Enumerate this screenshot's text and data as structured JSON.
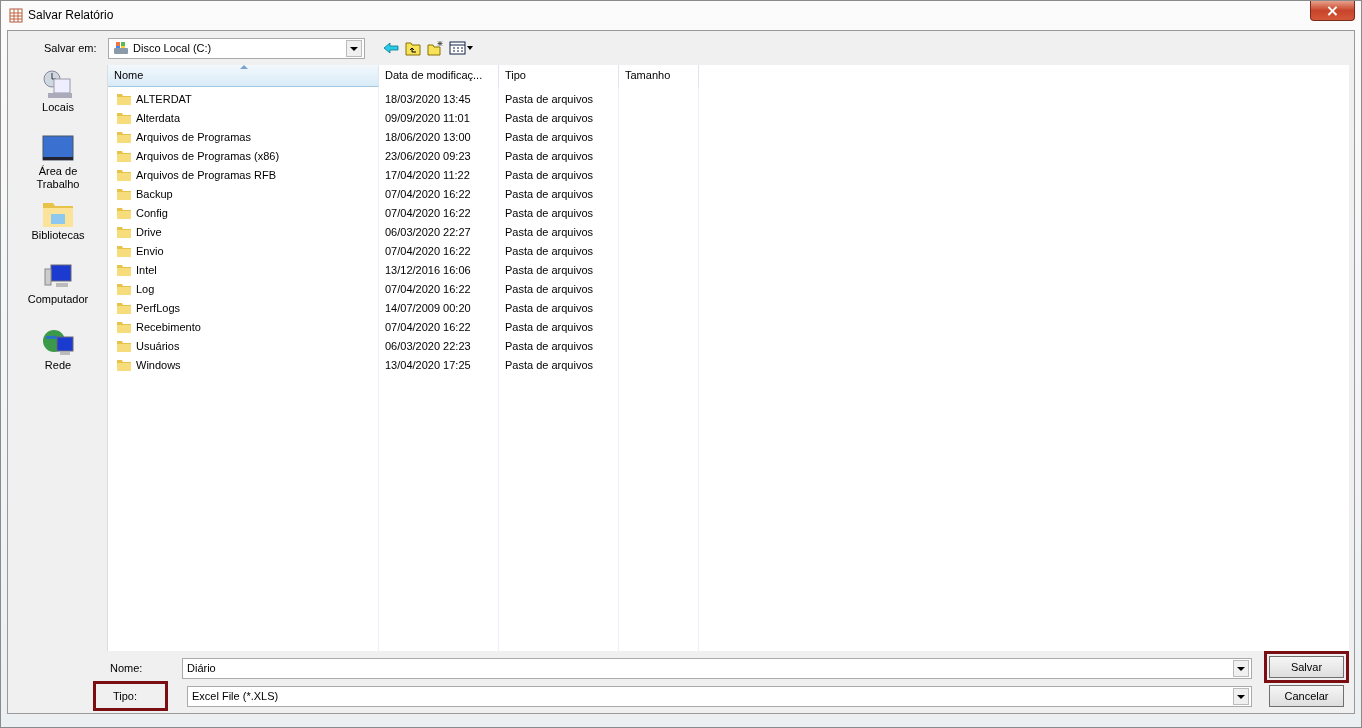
{
  "window": {
    "title": "Salvar Relatório",
    "close": "×"
  },
  "location": {
    "label": "Salvar em:",
    "value": "Disco Local (C:)"
  },
  "toolbar": [
    {
      "kind": "back"
    },
    {
      "kind": "up"
    },
    {
      "kind": "new-folder"
    },
    {
      "kind": "view"
    }
  ],
  "sidebar": {
    "items": [
      {
        "label": "Locais",
        "kind": "recent"
      },
      {
        "label": "Área de Trabalho",
        "kind": "desktop"
      },
      {
        "label": "Bibliotecas",
        "kind": "libraries"
      },
      {
        "label": "Computador",
        "kind": "computer"
      },
      {
        "label": "Rede",
        "kind": "network"
      }
    ]
  },
  "table": {
    "columns": [
      {
        "label": "Nome",
        "sorted": true
      },
      {
        "label": "Data de modificaç...",
        "sorted": false
      },
      {
        "label": "Tipo",
        "sorted": false
      },
      {
        "label": "Tamanho",
        "sorted": false
      }
    ],
    "rows": [
      {
        "name": "ALTERDAT",
        "date": "18/03/2020 13:45",
        "type": "Pasta de arquivos"
      },
      {
        "name": "Alterdata",
        "date": "09/09/2020 11:01",
        "type": "Pasta de arquivos"
      },
      {
        "name": "Arquivos de Programas",
        "date": "18/06/2020 13:00",
        "type": "Pasta de arquivos"
      },
      {
        "name": "Arquivos de Programas (x86)",
        "date": "23/06/2020 09:23",
        "type": "Pasta de arquivos"
      },
      {
        "name": "Arquivos de Programas RFB",
        "date": "17/04/2020 11:22",
        "type": "Pasta de arquivos"
      },
      {
        "name": "Backup",
        "date": "07/04/2020 16:22",
        "type": "Pasta de arquivos"
      },
      {
        "name": "Config",
        "date": "07/04/2020 16:22",
        "type": "Pasta de arquivos"
      },
      {
        "name": "Drive",
        "date": "06/03/2020 22:27",
        "type": "Pasta de arquivos"
      },
      {
        "name": "Envio",
        "date": "07/04/2020 16:22",
        "type": "Pasta de arquivos"
      },
      {
        "name": "Intel",
        "date": "13/12/2016 16:06",
        "type": "Pasta de arquivos"
      },
      {
        "name": "Log",
        "date": "07/04/2020 16:22",
        "type": "Pasta de arquivos"
      },
      {
        "name": "PerfLogs",
        "date": "14/07/2009 00:20",
        "type": "Pasta de arquivos"
      },
      {
        "name": "Recebimento",
        "date": "07/04/2020 16:22",
        "type": "Pasta de arquivos"
      },
      {
        "name": "Usuários",
        "date": "06/03/2020 22:23",
        "type": "Pasta de arquivos"
      },
      {
        "name": "Windows",
        "date": "13/04/2020 17:25",
        "type": "Pasta de arquivos"
      }
    ]
  },
  "fields": [
    {
      "label": "Nome:",
      "value": "Diário",
      "highlighted": false
    },
    {
      "label": "Tipo:",
      "value": "Excel File (*.XLS)",
      "highlighted": true
    }
  ],
  "buttons": [
    {
      "label": "Salvar",
      "highlighted": true
    },
    {
      "label": "Cancelar",
      "highlighted": false
    }
  ]
}
